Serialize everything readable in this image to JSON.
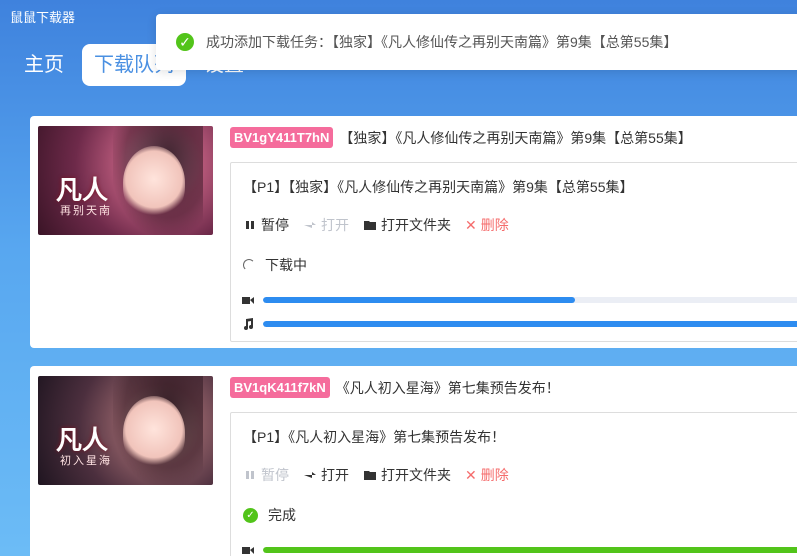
{
  "app": {
    "title": "鼠鼠下载器"
  },
  "nav": {
    "tabs": [
      {
        "label": "主页"
      },
      {
        "label": "下载队列"
      },
      {
        "label": "设置"
      }
    ]
  },
  "toast": {
    "message": "成功添加下载任务：【独家】《凡人修仙传之再别天南篇》第9集【总第55集】"
  },
  "items": [
    {
      "bvid": "BV1gY411T7hN",
      "title": "【独家】《凡人修仙传之再别天南篇》第9集【总第55集】",
      "thumb_title": "凡人",
      "thumb_sub": "再别天南",
      "part_title": "【P1】【独家】《凡人修仙传之再别天南篇》第9集【总第55集】",
      "actions": {
        "pause": "暂停",
        "open": "打开",
        "open_folder": "打开文件夹",
        "delete": "删除"
      },
      "status": "下载中",
      "video_progress": 0.55,
      "audio_progress": 1.0,
      "color": "#2d8cf0"
    },
    {
      "bvid": "BV1qK411f7kN",
      "title": "《凡人初入星海》第七集预告发布！",
      "thumb_title": "凡人",
      "thumb_sub": "初入星海",
      "part_title": "【P1】《凡人初入星海》第七集预告发布！",
      "actions": {
        "pause": "暂停",
        "open": "打开",
        "open_folder": "打开文件夹",
        "delete": "删除"
      },
      "status": "完成",
      "video_progress": 1.0,
      "color": "#52c41a"
    }
  ]
}
